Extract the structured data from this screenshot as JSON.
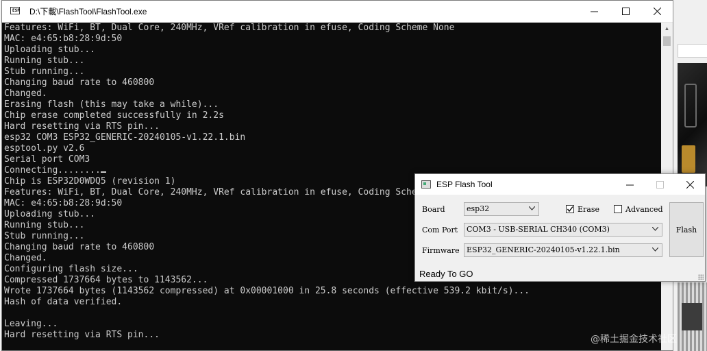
{
  "console": {
    "title": "D:\\下載\\FlashTool\\FlashTool.exe",
    "lines": [
      "Features: WiFi, BT, Dual Core, 240MHz, VRef calibration in efuse, Coding Scheme None",
      "MAC: e4:65:b8:28:9d:50",
      "Uploading stub...",
      "Running stub...",
      "Stub running...",
      "Changing baud rate to 460800",
      "Changed.",
      "Erasing flash (this may take a while)...",
      "Chip erase completed successfully in 2.2s",
      "Hard resetting via RTS pin...",
      "esp32 COM3 ESP32_GENERIC-20240105-v1.22.1.bin",
      "esptool.py v2.6",
      "Serial port COM3",
      "Connecting........",
      "Chip is ESP32D0WDQ5 (revision 1)",
      "Features: WiFi, BT, Dual Core, 240MHz, VRef calibration in efuse, Coding Scheme None",
      "MAC: e4:65:b8:28:9d:50",
      "Uploading stub...",
      "Running stub...",
      "Stub running...",
      "Changing baud rate to 460800",
      "Changed.",
      "Configuring flash size...",
      "Compressed 1737664 bytes to 1143562...",
      "Wrote 1737664 bytes (1143562 compressed) at 0x00001000 in 25.8 seconds (effective 539.2 kbit/s)...",
      "Hash of data verified.",
      "",
      "Leaving...",
      "Hard resetting via RTS pin..."
    ]
  },
  "flash_tool": {
    "title": "ESP Flash Tool",
    "board_label": "Board",
    "board_value": "esp32",
    "erase_label": "Erase",
    "erase_checked": true,
    "advanced_label": "Advanced",
    "advanced_checked": false,
    "port_label": "Com Port",
    "port_value": "COM3 - USB-SERIAL CH340 (COM3)",
    "firmware_label": "Firmware",
    "firmware_value": "ESP32_GENERIC-20240105-v1.22.1.bin",
    "flash_button": "Flash",
    "status": "Ready To GO"
  },
  "watermark": "@稀土掘金技术社区",
  "icons": [
    "console-app-icon",
    "minimize-icon",
    "maximize-icon",
    "close-icon",
    "flash-tool-app-icon",
    "chevron-down-icon",
    "checkmark-icon",
    "resize-grip-icon"
  ]
}
